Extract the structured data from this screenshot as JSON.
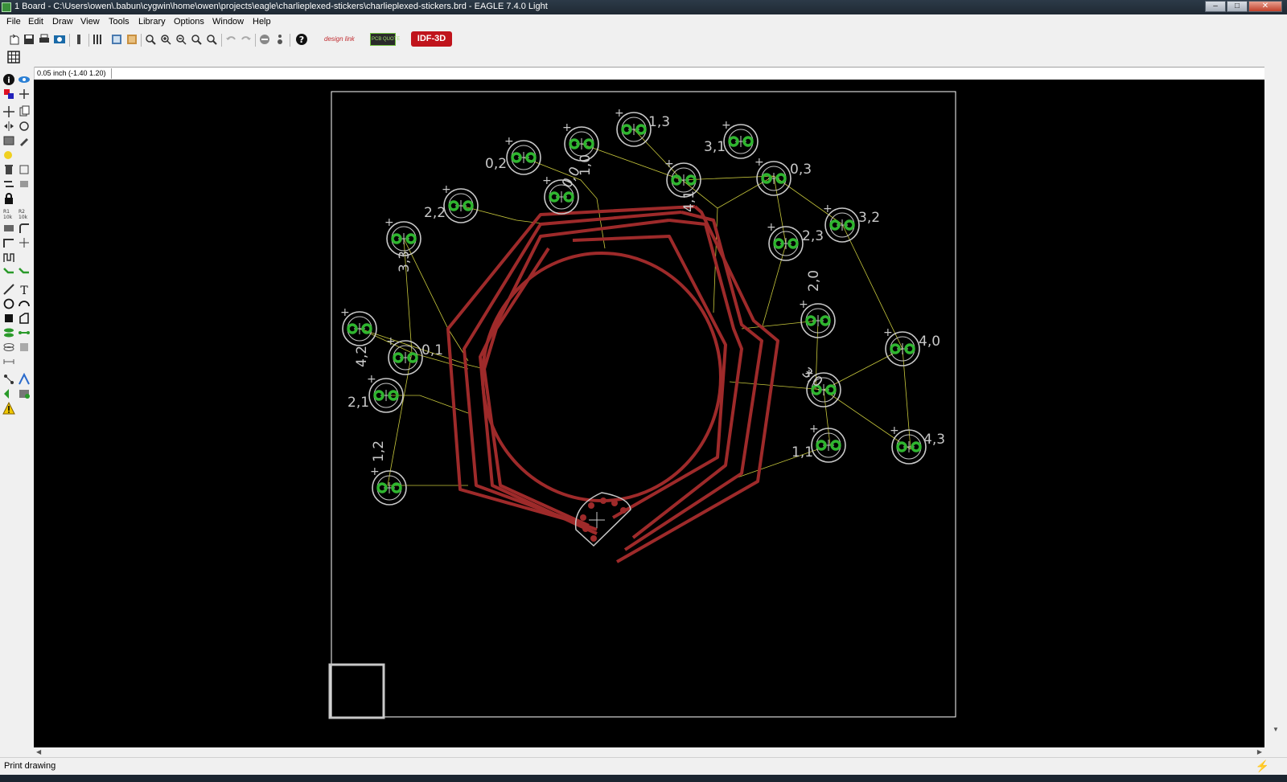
{
  "window": {
    "title": "1 Board - C:\\Users\\owen\\.babun\\cygwin\\home\\owen\\projects\\eagle\\charlieplexed-stickers\\charlieplexed-stickers.brd - EAGLE 7.4.0 Light",
    "minimize": "–",
    "maximize": "□",
    "close": "✕"
  },
  "menu": [
    "File",
    "Edit",
    "Draw",
    "View",
    "Tools",
    "Library",
    "Options",
    "Window",
    "Help"
  ],
  "toolbar": {
    "design_link": "design link",
    "pcb_quote": "PCB QUOTE",
    "idf3d": "IDF-3D"
  },
  "command_bar": {
    "coordinate": "0.05 inch (-1.40 1.20)",
    "command": ""
  },
  "status": {
    "text": "Print drawing"
  },
  "board": {
    "colors": {
      "background": "#000000",
      "outline": "#ffffff",
      "trace": "#9e2a2a",
      "pad": "#2fb52f",
      "silk": "#c8c8c8",
      "airwire": "#c8c83c"
    },
    "leds": [
      {
        "label": "1,3"
      },
      {
        "label": "0,2"
      },
      {
        "label": "1,0"
      },
      {
        "label": "0,0"
      },
      {
        "label": "3,1"
      },
      {
        "label": "4,1"
      },
      {
        "label": "0,3"
      },
      {
        "label": "2,2"
      },
      {
        "label": "3,2"
      },
      {
        "label": "2,3"
      },
      {
        "label": "3,3"
      },
      {
        "label": "2,0"
      },
      {
        "label": "4,2"
      },
      {
        "label": "0,1"
      },
      {
        "label": "4,0"
      },
      {
        "label": "3,0"
      },
      {
        "label": "2,1"
      },
      {
        "label": "1,1"
      },
      {
        "label": "4,3"
      },
      {
        "label": "1,2"
      }
    ]
  }
}
